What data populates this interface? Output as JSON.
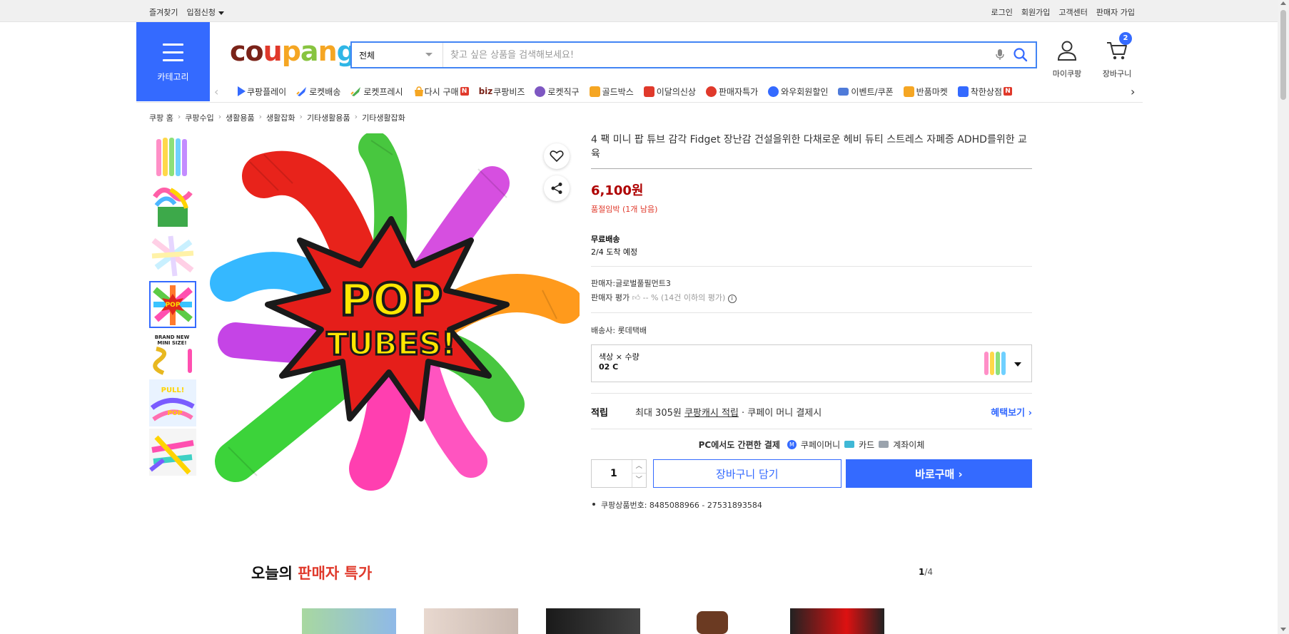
{
  "topbar": {
    "left": [
      "즐겨찾기",
      "입점신청"
    ],
    "right": [
      "로그인",
      "회원가입",
      "고객센터",
      "판매자 가입"
    ]
  },
  "header": {
    "category_label": "카테고리",
    "logo_text": "coupang",
    "search": {
      "category": "전체",
      "placeholder": "찾고 싶은 상품을 검색해보세요!"
    },
    "mypage_label": "마이쿠팡",
    "cart_label": "장바구니",
    "cart_count": "2"
  },
  "subnav": {
    "items": [
      {
        "label": "쿠팡플레이",
        "icon": "play-icon",
        "color": "#346aff"
      },
      {
        "label": "로켓배송",
        "icon": "rocket-icon",
        "color": "#346aff"
      },
      {
        "label": "로켓프레시",
        "icon": "rocket-fresh-icon",
        "color": "#4caf50"
      },
      {
        "label": "다시 구매",
        "icon": "rebuy-icon",
        "color": "#f5a623",
        "badge": "N"
      },
      {
        "label": "쿠팡비즈",
        "icon": "biz-icon",
        "prefix": "biz"
      },
      {
        "label": "로켓직구",
        "icon": "global-icon",
        "color": "#7e57c2"
      },
      {
        "label": "골드박스",
        "icon": "goldbox-icon",
        "color": "#f5a623"
      },
      {
        "label": "이달의신상",
        "icon": "new-icon",
        "color": "#e0392b"
      },
      {
        "label": "판매자특가",
        "icon": "seller-deal-icon",
        "color": "#e0392b"
      },
      {
        "label": "와우회원할인",
        "icon": "wow-icon",
        "color": "#346aff"
      },
      {
        "label": "이벤트/쿠폰",
        "icon": "coupon-icon",
        "color": "#4f7bd9"
      },
      {
        "label": "반품마켓",
        "icon": "return-market-icon",
        "color": "#f5a623"
      },
      {
        "label": "착한상점",
        "icon": "good-store-icon",
        "color": "#346aff",
        "badge": "N"
      }
    ]
  },
  "breadcrumb": [
    "쿠팡 홈",
    "쿠팡수입",
    "생활용품",
    "생활잡화",
    "기타생활용품",
    "기타생활잡화"
  ],
  "product": {
    "title": "4 팩 미니 팝 튜브 감각 Fidget 장난감 건설을위한 다채로운 헤비 듀티 스트레스 자폐증 ADHD를위한 교육",
    "price": "6,100원",
    "stock_note": "품절임박 (1개 남음)",
    "shipping_label": "무료배송",
    "arrival": "2/4 도착 예정",
    "seller": "판매자:글로벌풀필먼트3",
    "seller_rating_label": "판매자 평가",
    "seller_rating_value": "-- % (14건 이하의 평가)",
    "carrier": "배송사:  롯데택배",
    "option_label": "색상 × 수량",
    "option_value": "02 C",
    "reward_label": "적립",
    "reward_text_pre": "최대 305원 ",
    "reward_link": "쿠팡캐시 적립",
    "reward_text_post": " · 쿠페이 머니 결제시",
    "reward_more": "혜택보기 ›",
    "pay_title": "PC에서도 간편한 결제",
    "pay_methods": [
      "쿠페이머니",
      "카드",
      "계좌이체"
    ],
    "quantity": "1",
    "add_cart": "장바구니 담기",
    "buy_now": "바로구매 ›",
    "product_no": "쿠팡상품번호: 8485088966 - 27531893584"
  },
  "main_image": {
    "text_line1": "POP",
    "text_line2": "TUBES!"
  },
  "deals": {
    "title_pre": "오늘의 ",
    "title_red": "판매자 특가",
    "page_current": "1",
    "page_total": "/4"
  },
  "colors": {
    "brand_blue": "#346aff",
    "price_red": "#ae0000"
  }
}
